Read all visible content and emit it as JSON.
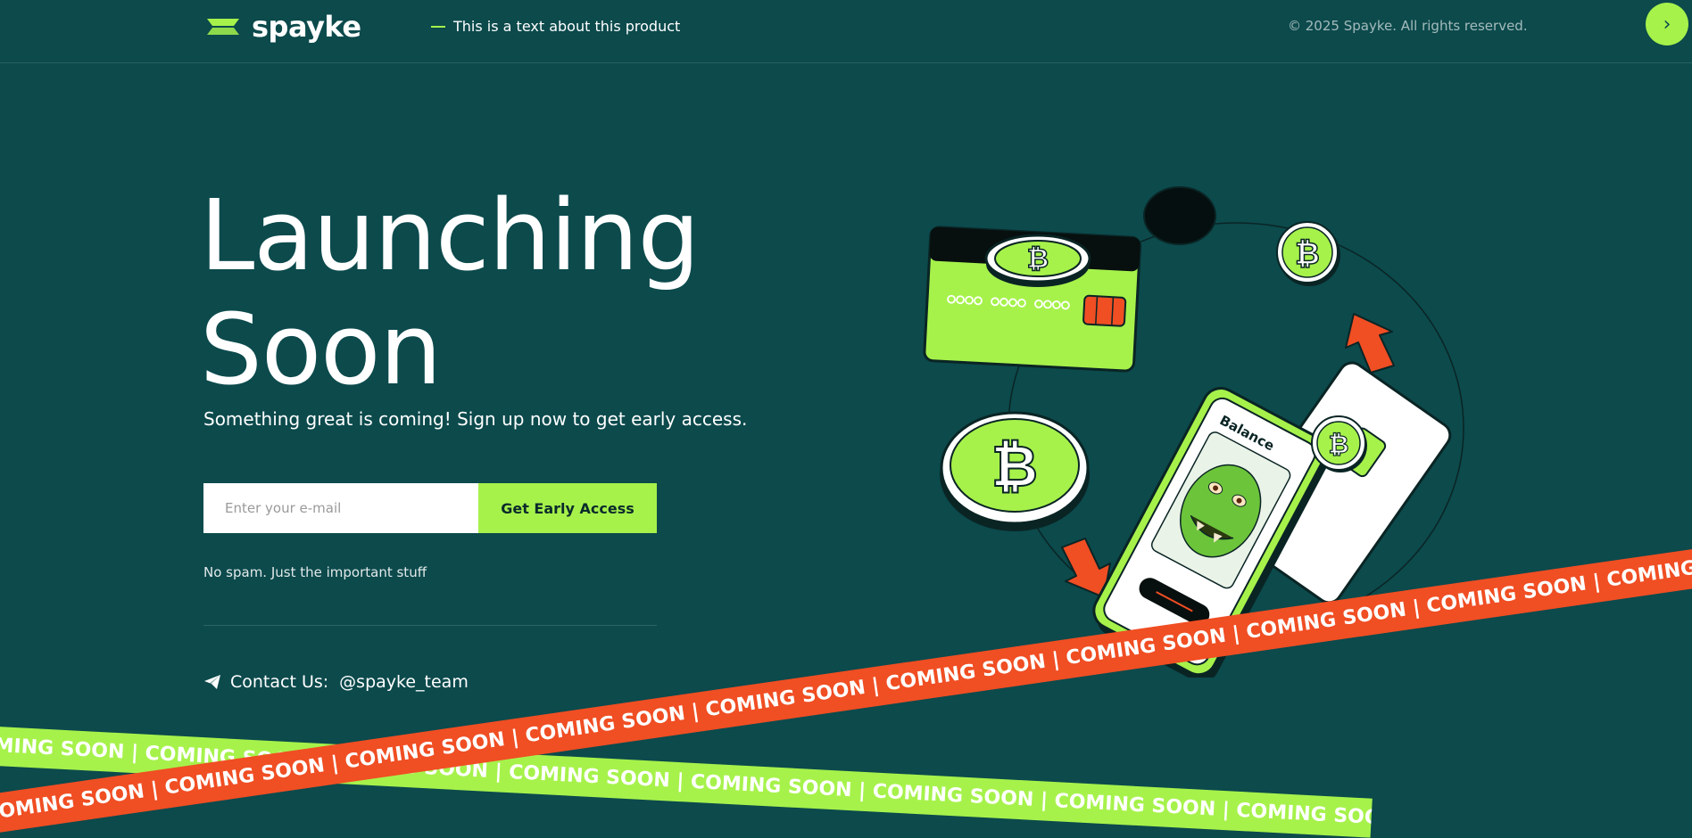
{
  "header": {
    "logo_text": "spayke",
    "tagline": "This is a text about this product",
    "copyright": "© 2025 Spayke. All rights reserved."
  },
  "hero": {
    "title_line1": "Launching",
    "title_line2": "Soon",
    "subtitle": "Something great is coming! Sign up now to get early access."
  },
  "signup": {
    "email_placeholder": "Enter your e-mail",
    "email_value": "",
    "button_label": "Get Early Access",
    "note": "No spam. Just the important stuff"
  },
  "contact": {
    "label": "Contact Us:",
    "handle": "@spayke_team"
  },
  "illustration": {
    "phone_balance_label": "Balance"
  },
  "ribbons": {
    "text": "COMING SOON   |   COMING SOON   |   COMING SOON   |   COMING SOON   |   COMING SOON   |   COMING SOON   |   COMING SOON   |   COMING SOON   |   COMING SOON   |   COMING SOON   |   COMING SOON   |   COMING SOON   |"
  },
  "colors": {
    "background": "#0c4a4c",
    "accent_green": "#a6f24b",
    "accent_orange": "#f04e23"
  },
  "icons": {
    "logo": "logo-mark-icon",
    "next": "chevron-right-icon",
    "contact": "telegram-send-icon"
  }
}
